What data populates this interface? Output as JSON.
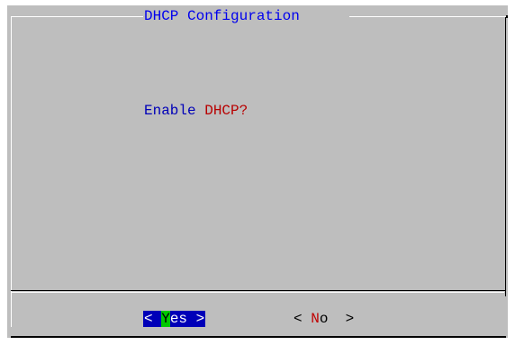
{
  "dialog": {
    "title": "DHCP Configuration",
    "prompt_prefix": "Enable",
    "prompt_highlight": "DHCP?"
  },
  "buttons": {
    "yes": {
      "left_bracket": "<",
      "hotkey": "Y",
      "rest": "es",
      "right_bracket": ">",
      "selected": true
    },
    "no": {
      "left_bracket": "<",
      "hotkey": "N",
      "rest": "o",
      "right_bracket": ">",
      "selected": false
    }
  },
  "colors": {
    "dialog_background": "#bebebe",
    "title_text": "#0000ee",
    "prompt_text": "#0000b8",
    "prompt_highlight_text": "#b80000",
    "selected_button_background": "#0000b8",
    "hotkey_highlight_background": "#00c800",
    "hotkey_text": "#c00000"
  }
}
